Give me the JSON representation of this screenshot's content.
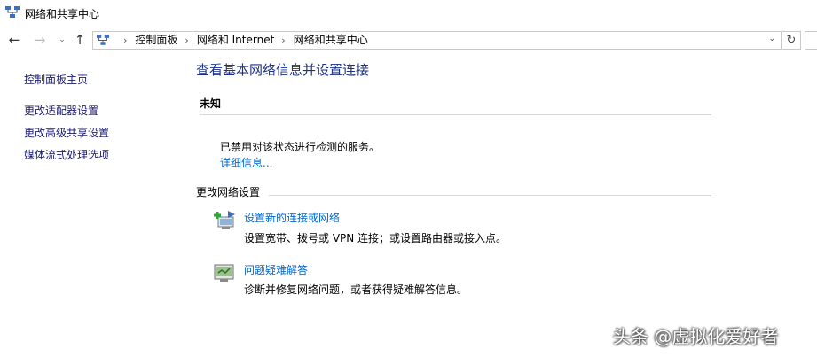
{
  "window": {
    "title": "网络和共享中心"
  },
  "address_bar": {
    "breadcrumbs": [
      "控制面板",
      "网络和 Internet",
      "网络和共享中心"
    ]
  },
  "sidebar": {
    "home": "控制面板主页",
    "items": [
      "更改适配器设置",
      "更改高级共享设置",
      "媒体流式处理选项"
    ]
  },
  "main": {
    "heading": "查看基本网络信息并设置连接",
    "network_name": "未知",
    "status_message": "已禁用对该状态进行检测的服务。",
    "details_link": "详细信息...",
    "change_section_title": "更改网络设置",
    "tasks": [
      {
        "title": "设置新的连接或网络",
        "description": "设置宽带、拨号或 VPN 连接；或设置路由器或接入点。",
        "icon": "new-connection-icon"
      },
      {
        "title": "问题疑难解答",
        "description": "诊断并修复网络问题，或者获得疑难解答信息。",
        "icon": "troubleshoot-icon"
      }
    ]
  },
  "watermark": "头条 @虚拟化爱好者"
}
